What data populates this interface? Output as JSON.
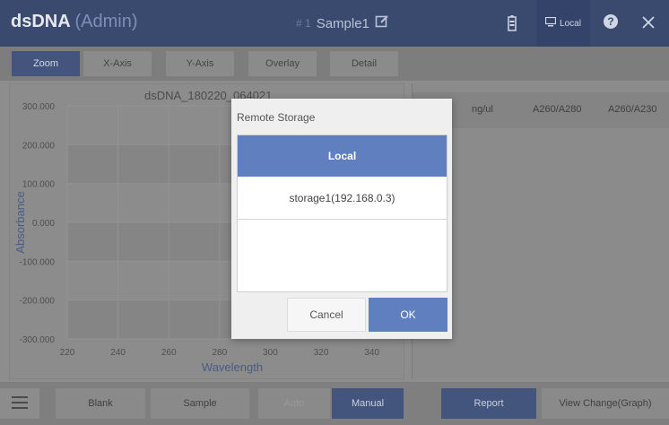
{
  "header": {
    "app_name": "dsDNA",
    "role": "(Admin)",
    "sample_hash": "# 1",
    "sample_name": "Sample1",
    "local_label": "Local"
  },
  "tabs": [
    "Zoom",
    "X-Axis",
    "Y-Axis",
    "Overlay",
    "Detail"
  ],
  "chart": {
    "title": "dsDNA_180220_064021"
  },
  "chart_data": {
    "type": "line",
    "title": "dsDNA_180220_064021",
    "xlabel": "Wavelength",
    "ylabel": "Absorbance",
    "xlim": [
      220,
      350
    ],
    "ylim": [
      -300,
      300
    ],
    "x_ticks": [
      "220",
      "240",
      "260",
      "280",
      "300",
      "320",
      "340"
    ],
    "y_ticks": [
      "300.000",
      "200.000",
      "100.000",
      "0.000",
      "-100.000",
      "-200.000",
      "-300.000"
    ],
    "series": [],
    "grid": true
  },
  "table": {
    "columns": [
      "ng/ul",
      "A260/A280",
      "A260/A230"
    ]
  },
  "bottom": {
    "blank": "Blank",
    "sample": "Sample",
    "auto": "Auto",
    "manual": "Manual",
    "report": "Report",
    "view_change": "View Change(Graph)"
  },
  "modal": {
    "title": "Remote Storage",
    "options": [
      "Local",
      "storage1(192.168.0.3)"
    ],
    "selected": "Local",
    "cancel": "Cancel",
    "ok": "OK"
  },
  "colors": {
    "header_bg": "#3a4a6e",
    "accent": "#5f7fbf",
    "active_tab": "#44557d"
  }
}
